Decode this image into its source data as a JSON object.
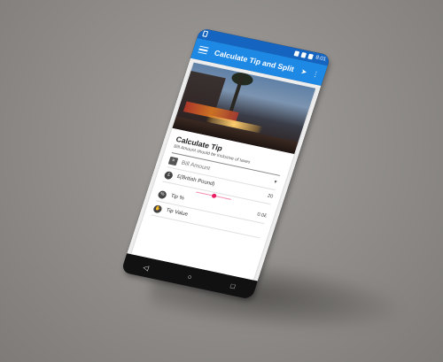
{
  "status_bar": {
    "time": "8:01"
  },
  "app_bar": {
    "title": "Calculate Tip and Split",
    "menu_icon": "hamburger-icon",
    "share_icon": "share-icon",
    "more_icon": "more-vert-icon",
    "color": "#1e88e5"
  },
  "card": {
    "title": "Calculate Tip",
    "subtitle": "Bill Amount should be inclusive of taxes",
    "bill_amount_placeholder": "Bill Amount",
    "currency": "£(British Pound)",
    "tip_percent_value": "20",
    "tip_percent_label": "Tip %",
    "tip_amount": "0.0£",
    "tip_value_label": "Tip Value"
  },
  "nav": {
    "back": "◁",
    "home": "○",
    "recents": "□"
  },
  "colors": {
    "accent": "#e91e63",
    "status_bar": "#1565c0"
  }
}
